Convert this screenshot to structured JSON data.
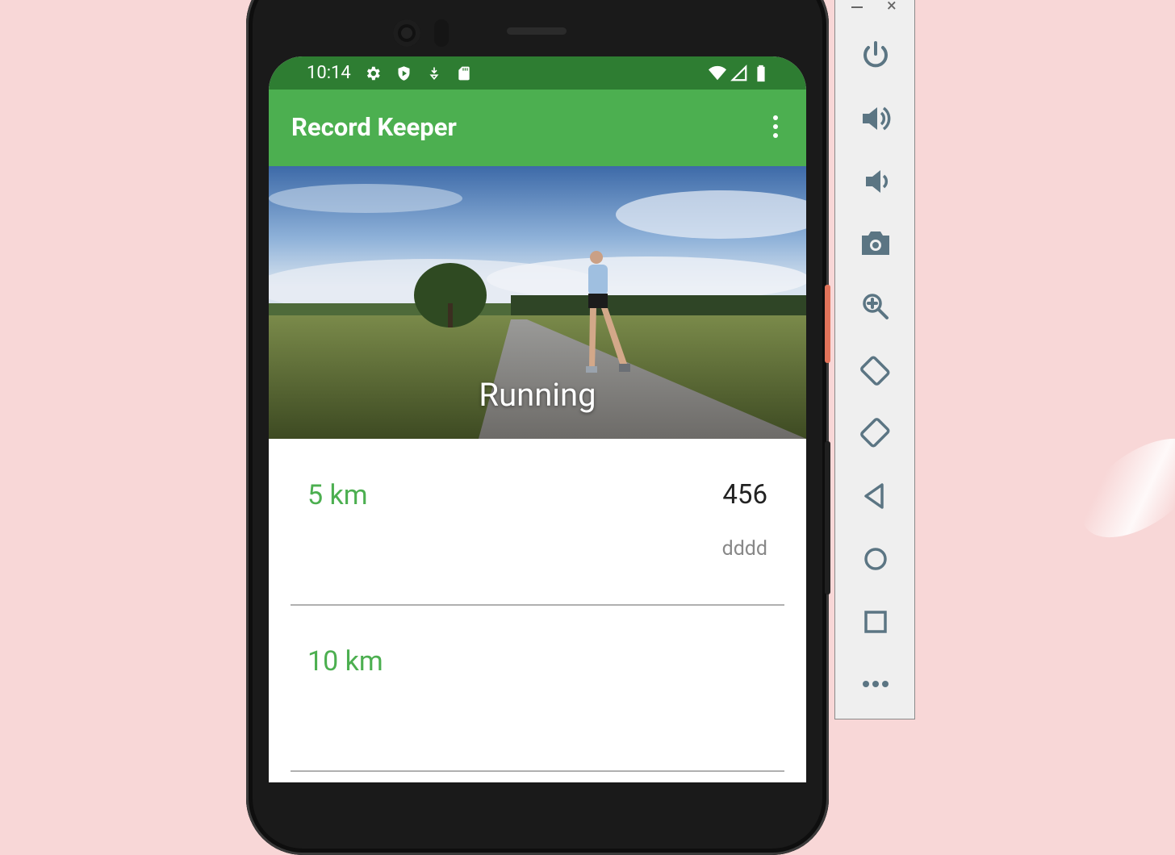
{
  "status_bar": {
    "time": "10:14",
    "left_icons": [
      "settings-gear-icon",
      "shield-icon",
      "download-icon",
      "sd-card-icon"
    ],
    "right_icons": [
      "wifi-icon",
      "signal-icon",
      "battery-icon"
    ]
  },
  "app_bar": {
    "title": "Record Keeper",
    "menu_icon": "more-vert-icon"
  },
  "hero": {
    "caption": "Running"
  },
  "records": [
    {
      "label": "5 km",
      "value": "456",
      "date": "dddd"
    },
    {
      "label": "10 km",
      "value": "",
      "date": ""
    }
  ],
  "emulator_toolbar": {
    "buttons": [
      "power-icon",
      "volume-up-icon",
      "volume-down-icon",
      "camera-icon",
      "zoom-icon",
      "rotate-left-icon",
      "rotate-right-icon",
      "back-icon",
      "home-icon",
      "overview-icon",
      "more-icon"
    ]
  },
  "colors": {
    "status_bar": "#2e7d32",
    "app_bar": "#4caf50",
    "accent": "#4caf50",
    "background": "#f8d7d7"
  }
}
